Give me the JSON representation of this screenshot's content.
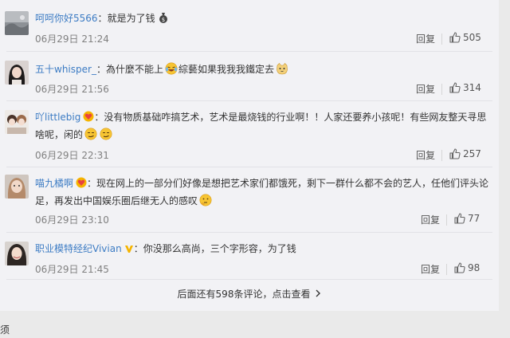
{
  "comments": [
    {
      "username": "呵呵你好5566",
      "text": "就是为了钱",
      "time": "06月29日 21:24",
      "reply_label": "回复",
      "likes": "505"
    },
    {
      "username": "五十whisper_",
      "text_a": "為什麼不能上",
      "text_b": "綜藝如果我我我鐵定去",
      "time": "06月29日 21:56",
      "reply_label": "回复",
      "likes": "314"
    },
    {
      "username": "吖littlebig",
      "text_line1": "没有物质基础咋搞艺术，艺术是最烧钱的行业啊！！人家还要养小孩呢！有些网友整天寻思",
      "text_line2": "啥呢，闲的",
      "time": "06月29日 22:31",
      "reply_label": "回复",
      "likes": "257"
    },
    {
      "username": "喵九橘啊",
      "text_line1": "现在网上的一部分们好像是想把艺术家们都饿死，剩下一群什么都不会的艺人，任他们评头论",
      "text_line2": "足，再发出中国娱乐圈后继无人的感叹",
      "time": "06月29日 23:10",
      "reply_label": "回复",
      "likes": "77"
    },
    {
      "username": "职业模特经纪Vivian",
      "text": "你没那么高尚，三个字形容，为了钱",
      "time": "06月29日 21:45",
      "reply_label": "回复",
      "likes": "98"
    }
  ],
  "separator": "：",
  "more_comments_label": "后面还有598条评论，点击查看",
  "bottom_fragment": "须",
  "colors": {
    "username": "#3d7cc4",
    "background": "#f2f2f5",
    "badge_gold": "#f5b400",
    "badge_red": "#e8423f"
  },
  "icons": {
    "like": "thumbs-up-icon",
    "more": "chevron-right-icon"
  }
}
